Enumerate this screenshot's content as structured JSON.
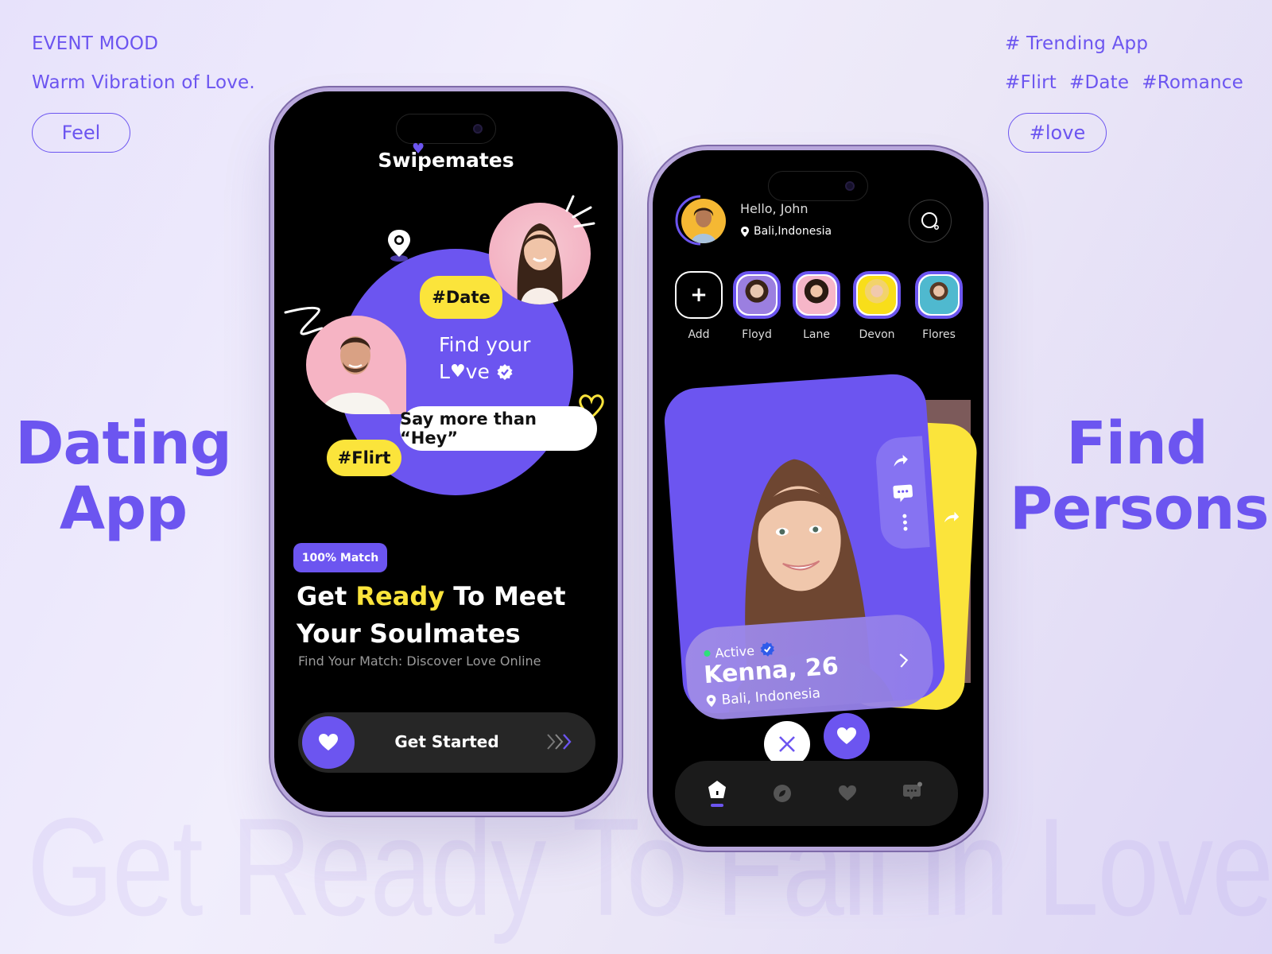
{
  "left_panel": {
    "eyebrow": "EVENT MOOD",
    "tagline": "Warm Vibration of Love.",
    "pill": "Feel",
    "title_line1": "Dating",
    "title_line2": "App"
  },
  "right_panel": {
    "eyebrow": "# Trending App",
    "hashtags": [
      "#Flirt",
      "#Date",
      "#Romance"
    ],
    "pill": "#love",
    "title_line1": "Find",
    "title_line2": "Persons"
  },
  "watermark": "Get Ready To Fall In Love",
  "colors": {
    "accent": "#6c55f0",
    "highlight": "#fbe43b",
    "background": "#ece8fb",
    "phone_bg": "#000000"
  },
  "onboarding": {
    "brand": "Swipemates",
    "tag_date": "#Date",
    "tag_flirt": "#Flirt",
    "find_line1": "Find your",
    "find_line2_pre": "L",
    "find_line2_post": "ve",
    "bubble": "Say more than “Hey”",
    "badge": "100%  Match",
    "headline_pre": "Get ",
    "headline_highlight": "Ready",
    "headline_post": " To Meet",
    "headline_line2": "Your Soulmates",
    "subline": "Find Your Match: Discover Love Online",
    "cta_label": "Get Started",
    "cta_arrows": "›››"
  },
  "discover": {
    "greeting": "Hello, John",
    "location": "Bali,Indonesia",
    "stories": [
      {
        "label": "Add"
      },
      {
        "label": "Floyd",
        "bg": "#9b7fe0"
      },
      {
        "label": "Lane",
        "bg": "#f6b6c8"
      },
      {
        "label": "Devon",
        "bg": "#f8de1a"
      },
      {
        "label": "Flores",
        "bg": "#4fb9cf"
      }
    ],
    "profile": {
      "status": "Active",
      "name": "Kenna, 26",
      "location": "Bali, Indonesia"
    },
    "nav": [
      "home",
      "explore",
      "favorites",
      "messages"
    ]
  }
}
